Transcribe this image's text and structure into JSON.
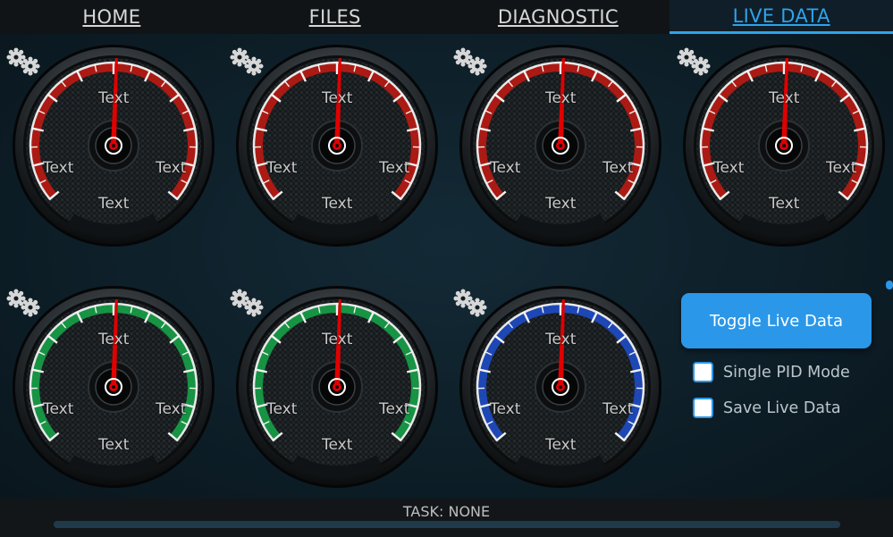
{
  "tabs": [
    {
      "label": "HOME",
      "active": false
    },
    {
      "label": "FILES",
      "active": false
    },
    {
      "label": "DIAGNOSTIC",
      "active": false
    },
    {
      "label": "LIVE DATA",
      "active": true
    }
  ],
  "gauges": [
    {
      "theme": "red",
      "accent": "#c41a12",
      "top_label": "Text",
      "left_label": "Text",
      "right_label": "Text",
      "bottom_label": "Text",
      "gear_icon": "gears-icon"
    },
    {
      "theme": "red",
      "accent": "#c41a12",
      "top_label": "Text",
      "left_label": "Text",
      "right_label": "Text",
      "bottom_label": "Text",
      "gear_icon": "gears-icon"
    },
    {
      "theme": "red",
      "accent": "#c41a12",
      "top_label": "Text",
      "left_label": "Text",
      "right_label": "Text",
      "bottom_label": "Text",
      "gear_icon": "gears-icon"
    },
    {
      "theme": "red",
      "accent": "#c41a12",
      "top_label": "Text",
      "left_label": "Text",
      "right_label": "Text",
      "bottom_label": "Text",
      "gear_icon": "gears-icon"
    },
    {
      "theme": "green",
      "accent": "#16a84a",
      "top_label": "Text",
      "left_label": "Text",
      "right_label": "Text",
      "bottom_label": "Text",
      "gear_icon": "gears-icon"
    },
    {
      "theme": "green",
      "accent": "#16a84a",
      "top_label": "Text",
      "left_label": "Text",
      "right_label": "Text",
      "bottom_label": "Text",
      "gear_icon": "gears-icon"
    },
    {
      "theme": "blue",
      "accent": "#1f4fd0",
      "top_label": "Text",
      "left_label": "Text",
      "right_label": "Text",
      "bottom_label": "Text",
      "gear_icon": "gears-icon"
    }
  ],
  "controls": {
    "toggle_label": "Toggle Live Data",
    "single_pid_label": "Single PID Mode",
    "single_pid_checked": false,
    "save_live_label": "Save Live Data",
    "save_live_checked": false
  },
  "status": {
    "task_text": "TASK: NONE"
  },
  "colors": {
    "accent": "#2b97e8",
    "needle": "#e00000"
  }
}
